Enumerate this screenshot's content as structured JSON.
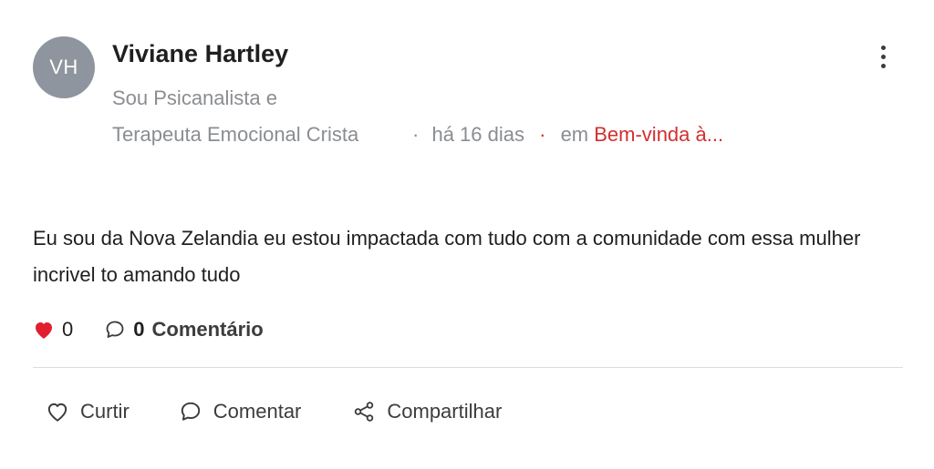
{
  "author": {
    "initials": "VH",
    "name": "Viviane Hartley",
    "bio": "Sou Psicanalista e Terapeuta Emocional Crista"
  },
  "meta": {
    "separator": "·",
    "time": "há 16 dias",
    "in_label": "em",
    "group": "Bem-vinda à..."
  },
  "post": {
    "text": "Eu sou da Nova Zelandia eu estou impactada com tudo com a comunidade com essa mulher incrivel to amando tudo"
  },
  "stats": {
    "likes": "0",
    "comments_count": "0",
    "comments_label": "Comentário"
  },
  "actions": {
    "like": "Curtir",
    "comment": "Comentar",
    "share": "Compartilhar"
  },
  "icons": {
    "more": "more-vertical-icon",
    "heart_filled": "heart-filled-icon",
    "comment": "comment-bubble-icon",
    "heart_outline": "heart-outline-icon",
    "share": "share-icon"
  },
  "colors": {
    "accent": "#d32f2f",
    "avatar_bg": "#8f959e",
    "muted_text": "#8a8d91"
  }
}
